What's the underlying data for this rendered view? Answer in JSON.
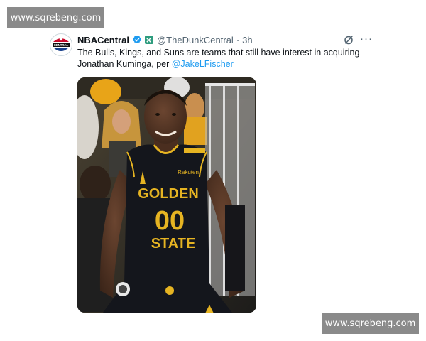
{
  "watermarks": {
    "top": "www.sqrebeng.com",
    "bottom": "www.sqrebeng.com"
  },
  "tweet": {
    "display_name": "NBACentral",
    "handle": "@TheDunkCentral",
    "separator": "·",
    "time": "3h",
    "more": "···",
    "text_line1": "The Bulls, Kings, and Suns are teams that still have interest in acquiring",
    "text_line2_prefix": "Jonathan Kuminga, per ",
    "mention": "@JakeLFischer",
    "avatar_text": "CENTRAL"
  },
  "jersey": {
    "sponsor": "Rakuten",
    "word1": "GOLDEN",
    "number": "00",
    "word2": "STATE"
  },
  "icons": {
    "verified": "verified-badge-icon",
    "affiliate": "affiliate-badge-icon",
    "grok": "grok-icon",
    "more": "more-options-icon",
    "avatar": "nba-logo-icon"
  },
  "colors": {
    "mention": "#1d9bf0",
    "verified": "#1d9bf0",
    "jersey": "#14161c",
    "jersey_text": "#e6b422",
    "watermark_bg": "#8a8a8a"
  }
}
